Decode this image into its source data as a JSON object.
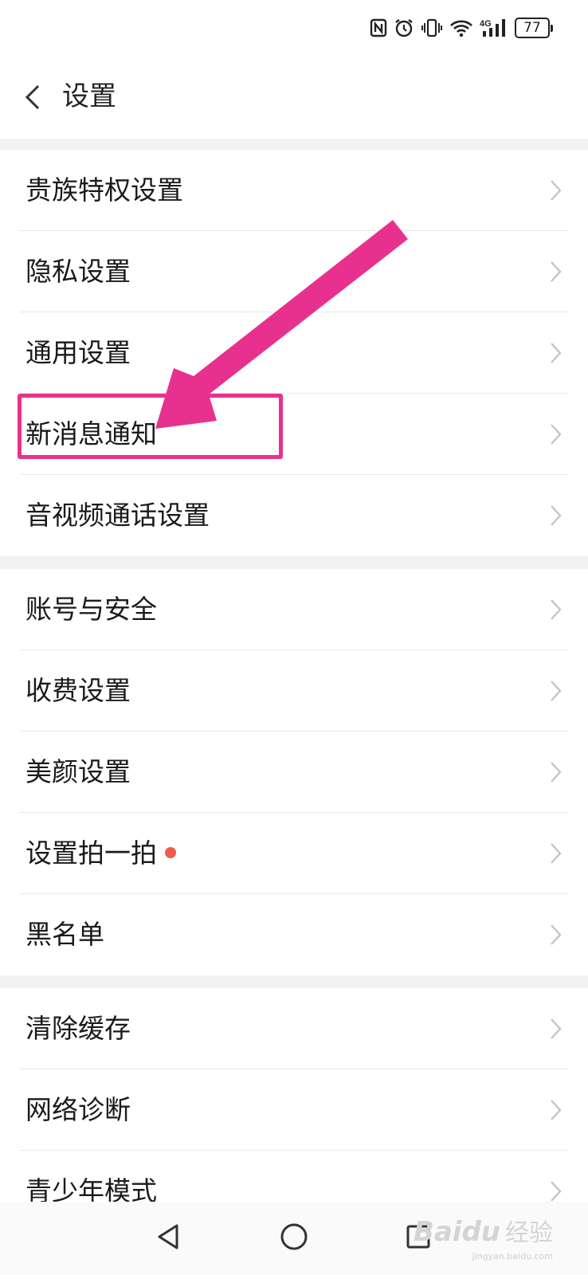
{
  "status_bar": {
    "icons": [
      "nfc-icon",
      "alarm-icon",
      "vibrate-icon",
      "wifi-icon",
      "signal-4g-icon",
      "battery-icon"
    ],
    "network_label": "4G",
    "battery_level": "77"
  },
  "header": {
    "title": "设置",
    "back_icon": "chevron-left-icon"
  },
  "sections": [
    {
      "items": [
        {
          "label": "贵族特权设置"
        },
        {
          "label": "隐私设置"
        },
        {
          "label": "通用设置"
        },
        {
          "label": "新消息通知"
        },
        {
          "label": "音视频通话设置"
        }
      ]
    },
    {
      "items": [
        {
          "label": "账号与安全"
        },
        {
          "label": "收费设置"
        },
        {
          "label": "美颜设置"
        },
        {
          "label": "设置拍一拍",
          "badge": "red-dot"
        },
        {
          "label": "黑名单"
        }
      ]
    },
    {
      "items": [
        {
          "label": "清除缓存"
        },
        {
          "label": "网络诊断"
        },
        {
          "label": "青少年模式"
        }
      ]
    }
  ],
  "annotation": {
    "target_label": "新消息通知",
    "color": "#e8318e"
  },
  "nav_bar": {
    "buttons": [
      "back-triangle-icon",
      "home-circle-icon",
      "recents-square-icon"
    ]
  },
  "watermark": {
    "brand": "Baidu",
    "product": "经验",
    "url": "jingyan.baidu.com"
  },
  "colors": {
    "background": "#ffffff",
    "section_gap": "#f2f2f2",
    "divider": "#e7e7e7",
    "chevron": "#c4c4c4",
    "badge_dot": "#f25a4a",
    "annotation": "#e8318e"
  }
}
